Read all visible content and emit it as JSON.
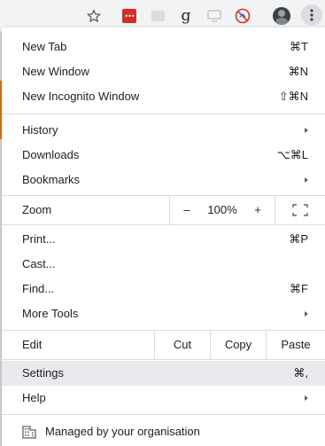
{
  "toolbar": {
    "icons": [
      "star-icon",
      "lastpass-icon",
      "extension-icon",
      "grammarly-icon",
      "cast-icon",
      "no-sync-icon",
      "avatar",
      "kebab-menu-icon"
    ]
  },
  "menu": {
    "new_tab": {
      "label": "New Tab",
      "shortcut": "⌘T"
    },
    "new_window": {
      "label": "New Window",
      "shortcut": "⌘N"
    },
    "new_incognito": {
      "label": "New Incognito Window",
      "shortcut": "⇧⌘N"
    },
    "history": {
      "label": "History"
    },
    "downloads": {
      "label": "Downloads",
      "shortcut": "⌥⌘L"
    },
    "bookmarks": {
      "label": "Bookmarks"
    },
    "zoom": {
      "label": "Zoom",
      "minus": "–",
      "value": "100%",
      "plus": "+"
    },
    "print": {
      "label": "Print...",
      "shortcut": "⌘P"
    },
    "cast": {
      "label": "Cast..."
    },
    "find": {
      "label": "Find...",
      "shortcut": "⌘F"
    },
    "more_tools": {
      "label": "More Tools"
    },
    "edit": {
      "label": "Edit",
      "cut": "Cut",
      "copy": "Copy",
      "paste": "Paste"
    },
    "settings": {
      "label": "Settings",
      "shortcut": "⌘,"
    },
    "help": {
      "label": "Help"
    },
    "managed": {
      "label": "Managed by your organisation"
    }
  },
  "colors": {
    "toolbar_bg": "#f1f3f4",
    "highlight_bg": "#e8eaed",
    "separator": "#dadce0",
    "lastpass_red": "#d32d27",
    "nosync_red": "#d93025"
  }
}
